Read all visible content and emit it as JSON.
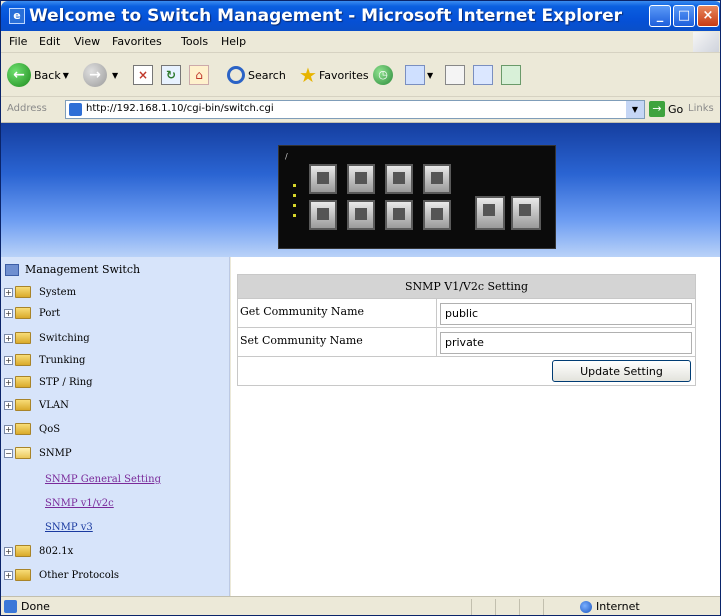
{
  "window": {
    "title": "Welcome to Switch Management - Microsoft Internet Explorer",
    "icon_name": "ie-page-icon"
  },
  "menubar": {
    "items": [
      "File",
      "Edit",
      "View",
      "Favorites",
      "Tools",
      "Help"
    ]
  },
  "toolbar": {
    "back_label": "Back",
    "search_label": "Search",
    "favorites_label": "Favorites"
  },
  "addressbar": {
    "label": "Address",
    "url": "http://192.168.1.10/cgi-bin/switch.cgi",
    "go_label": "Go",
    "links_label": "Links"
  },
  "sidebar": {
    "root_label": "Management Switch",
    "items": [
      "System",
      "Port",
      "Switching",
      "Trunking",
      "STP / Ring",
      "VLAN",
      "QoS",
      "SNMP"
    ],
    "snmp_children": [
      "SNMP General Setting",
      "SNMP v1/v2c",
      "SNMP v3"
    ],
    "items_after": [
      "802.1x",
      "Other Protocols"
    ]
  },
  "form": {
    "header": "SNMP V1/V2c Setting",
    "get_label": "Get Community Name",
    "get_value": "public",
    "set_label": "Set Community Name",
    "set_value": "private",
    "update_button": "Update Setting"
  },
  "statusbar": {
    "status": "Done",
    "zone": "Internet"
  },
  "colors": {
    "titlebar_blue": "#0551d8",
    "sidebar_bg": "#d7e4fa",
    "banner_top": "#153e9f",
    "banner_bottom": "#b9d2f8",
    "panel_header_bg": "#d4d4d4"
  }
}
